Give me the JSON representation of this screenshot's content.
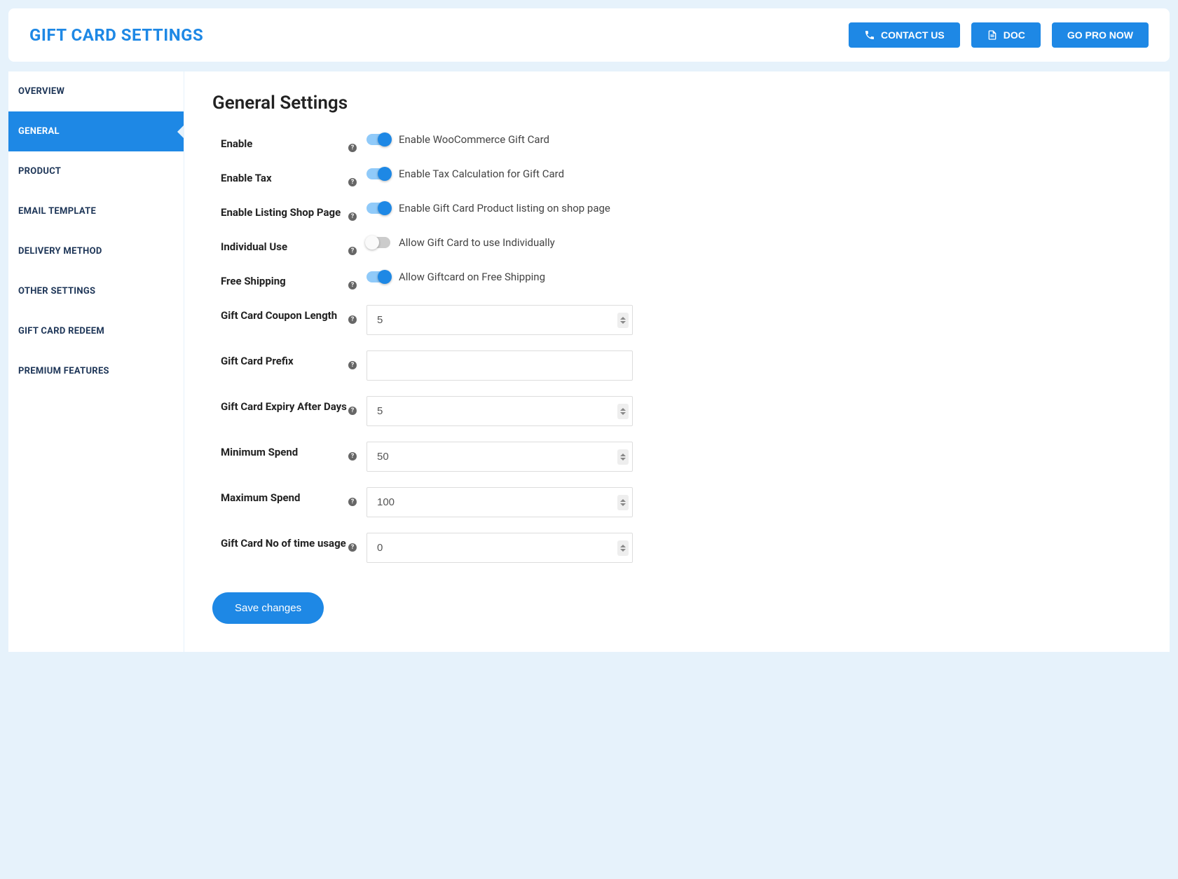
{
  "header": {
    "title": "GIFT CARD SETTINGS",
    "contact_label": "CONTACT US",
    "doc_label": "DOC",
    "pro_label": "GO PRO NOW"
  },
  "sidebar": {
    "items": [
      {
        "label": "OVERVIEW",
        "active": false
      },
      {
        "label": "GENERAL",
        "active": true
      },
      {
        "label": "PRODUCT",
        "active": false
      },
      {
        "label": "EMAIL TEMPLATE",
        "active": false
      },
      {
        "label": "DELIVERY METHOD",
        "active": false
      },
      {
        "label": "OTHER SETTINGS",
        "active": false
      },
      {
        "label": "GIFT CARD REDEEM",
        "active": false
      },
      {
        "label": "PREMIUM FEATURES",
        "active": false
      }
    ]
  },
  "content": {
    "title": "General Settings",
    "rows": {
      "enable": {
        "label": "Enable",
        "desc": "Enable WooCommerce Gift Card",
        "on": true
      },
      "enable_tax": {
        "label": "Enable Tax",
        "desc": "Enable Tax Calculation for Gift Card",
        "on": true
      },
      "listing": {
        "label": "Enable Listing Shop Page",
        "desc": "Enable Gift Card Product listing on shop page",
        "on": true
      },
      "individual": {
        "label": "Individual Use",
        "desc": "Allow Gift Card to use Individually",
        "on": false
      },
      "shipping": {
        "label": "Free Shipping",
        "desc": "Allow Giftcard on Free Shipping",
        "on": true
      },
      "coupon_length": {
        "label": "Gift Card Coupon Length",
        "value": "5"
      },
      "prefix": {
        "label": "Gift Card Prefix",
        "value": ""
      },
      "expiry": {
        "label": "Gift Card Expiry After Days",
        "value": "5"
      },
      "min_spend": {
        "label": "Minimum Spend",
        "value": "50"
      },
      "max_spend": {
        "label": "Maximum Spend",
        "value": "100"
      },
      "usage": {
        "label": "Gift Card No of time usage",
        "value": "0"
      }
    },
    "save_label": "Save changes"
  }
}
